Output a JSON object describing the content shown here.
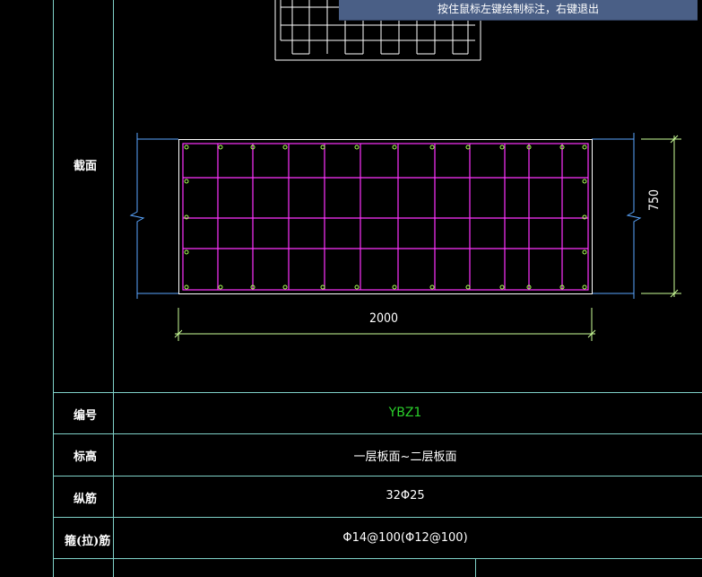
{
  "tooltip": "按住鼠标左键绘制标注，右键退出",
  "table": {
    "section_label": "截面",
    "rows": [
      {
        "label": "编号",
        "value": "YBZ1"
      },
      {
        "label": "标高",
        "value": "一层板面~二层板面"
      },
      {
        "label": "纵筋",
        "value": "32Φ25"
      },
      {
        "label": "箍(拉)筋",
        "value": "Φ14@100(Φ12@100)"
      }
    ]
  },
  "drawing": {
    "width_dim": "2000",
    "height_dim": "750"
  },
  "colors": {
    "background": "#000000",
    "table_lines": "#7fd1c8",
    "section_outline": "#ffffff",
    "stirrups": "#ff33ff",
    "bars": "#aaff55",
    "dimension": "#ccff99",
    "wall_edge": "#5aa6ff",
    "code_text": "#2bd12b",
    "tooltip_bg": "#4a5f86"
  }
}
